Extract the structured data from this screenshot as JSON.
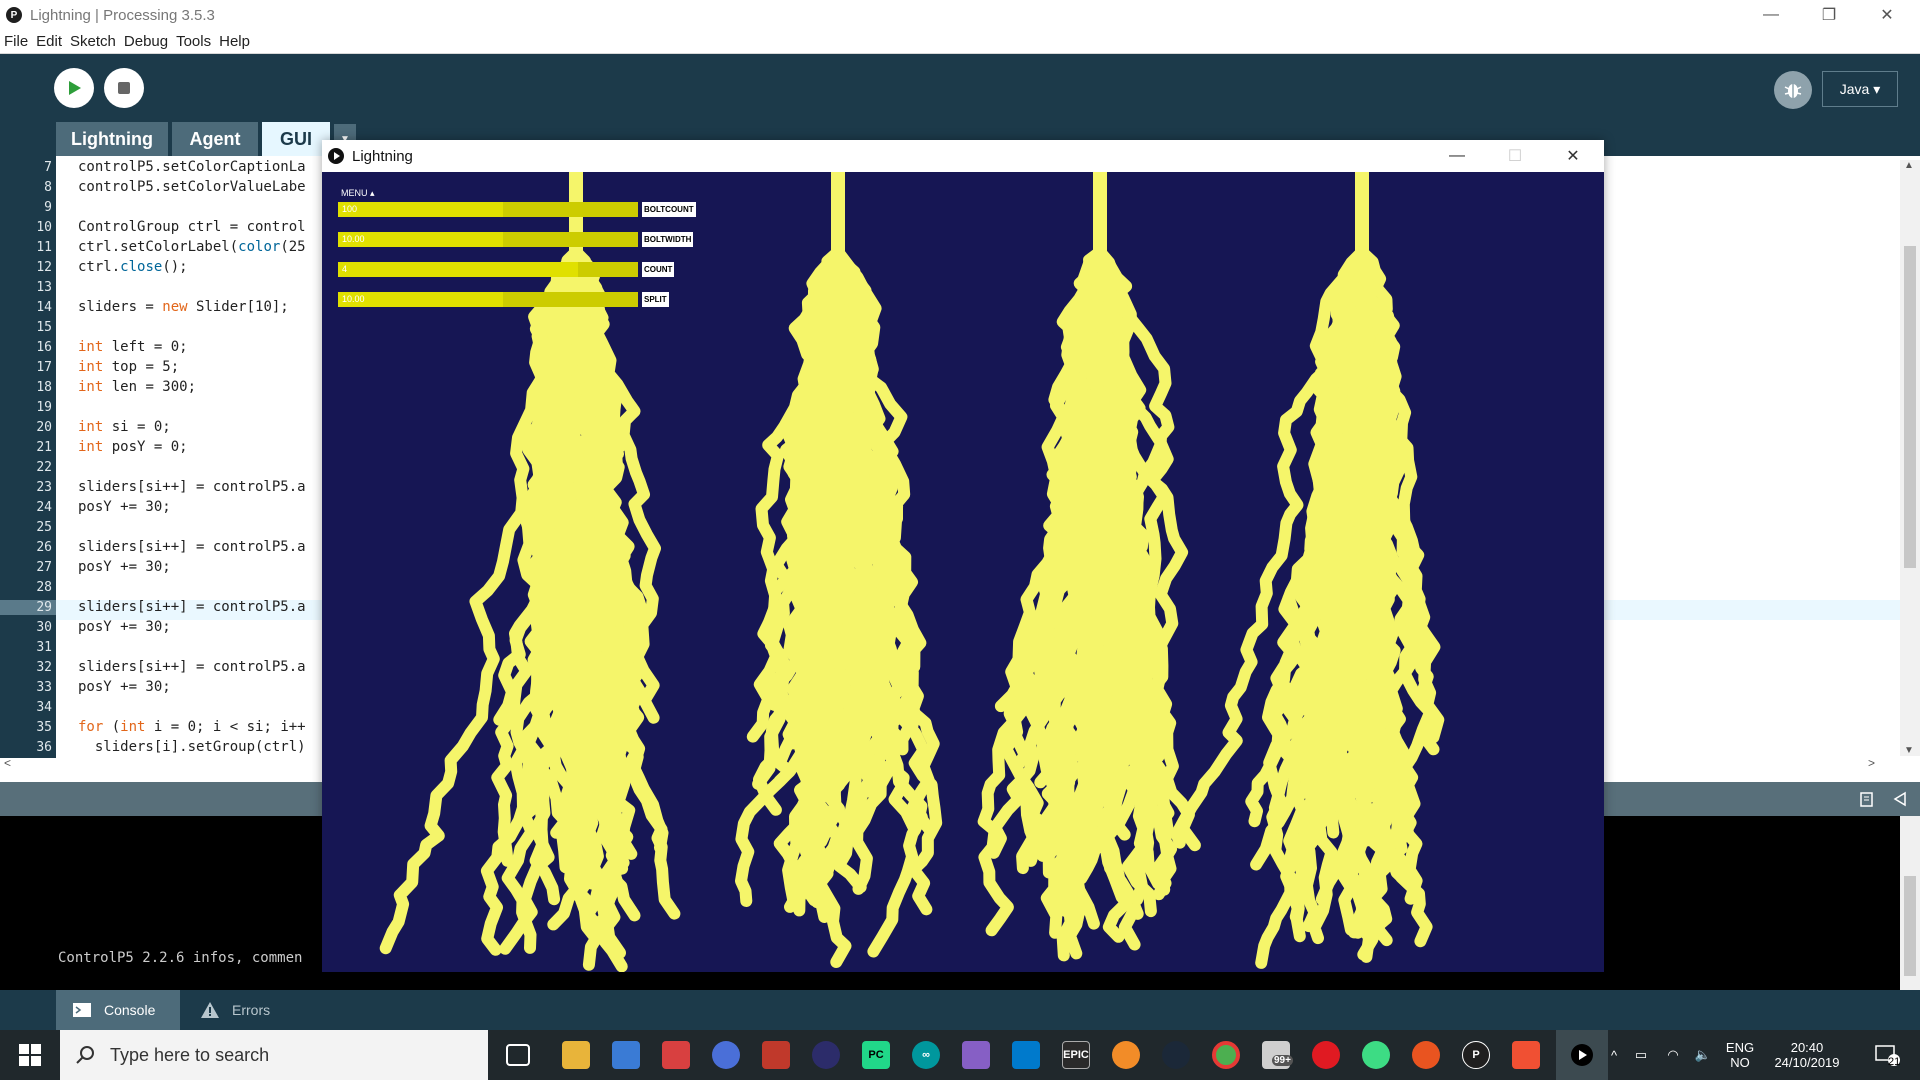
{
  "window": {
    "title": "Lightning | Processing 3.5.3",
    "app_icon": "P",
    "minimize": "—",
    "maximize": "❐",
    "close": "✕"
  },
  "menu": [
    "File",
    "Edit",
    "Sketch",
    "Debug",
    "Tools",
    "Help"
  ],
  "toolbar": {
    "mode": "Java ▾",
    "debug_icon": "bug-icon"
  },
  "tabs": [
    {
      "label": "Lightning",
      "active": false
    },
    {
      "label": "Agent",
      "active": false
    },
    {
      "label": "GUI",
      "active": true
    }
  ],
  "tab_arrow": "▼",
  "editor": {
    "current_line": "29",
    "lines": [
      {
        "n": "7",
        "text": "controlP5.setColorCaptionLa"
      },
      {
        "n": "8",
        "text": "controlP5.setColorValueLabe"
      },
      {
        "n": "9",
        "text": ""
      },
      {
        "n": "10",
        "text": "ControlGroup ctrl = control"
      },
      {
        "n": "11",
        "text": "ctrl.setColorLabel(color(25"
      },
      {
        "n": "12",
        "text": "ctrl.close();"
      },
      {
        "n": "13",
        "text": ""
      },
      {
        "n": "14",
        "text": "sliders = new Slider[10];"
      },
      {
        "n": "15",
        "text": ""
      },
      {
        "n": "16",
        "text": "int left = 0;"
      },
      {
        "n": "17",
        "text": "int top = 5;"
      },
      {
        "n": "18",
        "text": "int len = 300;"
      },
      {
        "n": "19",
        "text": ""
      },
      {
        "n": "20",
        "text": "int si = 0;"
      },
      {
        "n": "21",
        "text": "int posY = 0;"
      },
      {
        "n": "22",
        "text": ""
      },
      {
        "n": "23",
        "text": "sliders[si++] = controlP5.a"
      },
      {
        "n": "24",
        "text": "posY += 30;"
      },
      {
        "n": "25",
        "text": ""
      },
      {
        "n": "26",
        "text": "sliders[si++] = controlP5.a"
      },
      {
        "n": "27",
        "text": "posY += 30;"
      },
      {
        "n": "28",
        "text": ""
      },
      {
        "n": "29",
        "text": "sliders[si++] = controlP5.a"
      },
      {
        "n": "30",
        "text": "posY += 30;"
      },
      {
        "n": "31",
        "text": ""
      },
      {
        "n": "32",
        "text": "sliders[si++] = controlP5.a"
      },
      {
        "n": "33",
        "text": "posY += 30;"
      },
      {
        "n": "34",
        "text": ""
      },
      {
        "n": "35",
        "text": "for (int i = 0; i < si; i++"
      },
      {
        "n": "36",
        "text": "  sliders[i].setGroup(ctrl)"
      }
    ]
  },
  "console": {
    "text": "ControlP5 2.2.6 infos, commen"
  },
  "bottom_tabs": [
    {
      "label": "Console",
      "icon": "console-icon"
    },
    {
      "label": "Errors",
      "icon": "warning-icon"
    }
  ],
  "sketch": {
    "title": "Lightning",
    "menu_label": "MENU ▴",
    "bg_color": "#161654",
    "bolt_color": "#f5f56a",
    "sliders": [
      {
        "value": "100",
        "label": "BOLTCOUNT",
        "fraction": 0.55
      },
      {
        "value": "10.00",
        "label": "BOLTWIDTH",
        "fraction": 0.55
      },
      {
        "value": "4",
        "label": "COUNT",
        "fraction": 0.8
      },
      {
        "value": "10.00",
        "label": "SPLIT",
        "fraction": 0.55
      }
    ]
  },
  "taskbar": {
    "search_placeholder": "Type here to search",
    "badge": "99+",
    "lang": "ENG",
    "region": "NO",
    "time": "20:40",
    "date": "24/10/2019",
    "notifications": "21"
  }
}
